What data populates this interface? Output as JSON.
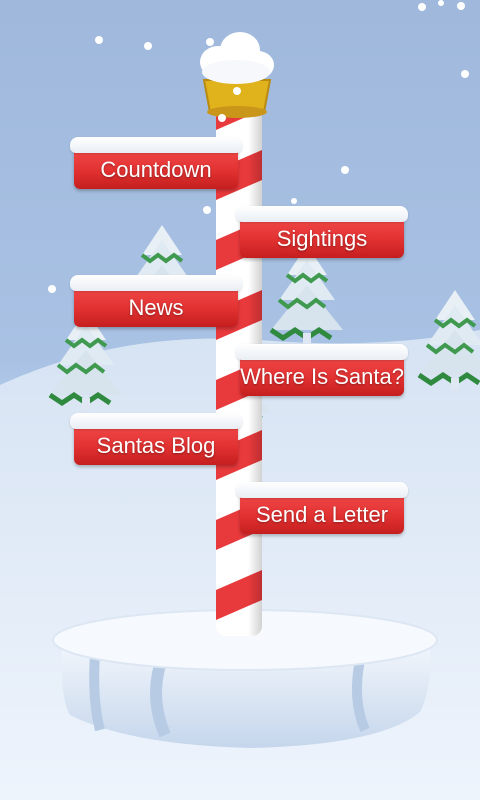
{
  "menu": {
    "countdown": "Countdown",
    "sightings": "Sightings",
    "news": "News",
    "where_is_santa": "Where Is Santa?",
    "santas_blog": "Santas Blog",
    "send_a_letter": "Send a Letter"
  },
  "colors": {
    "sign_red": "#e33232",
    "pole_red": "#e8393c",
    "sky": "#9fb8dc",
    "snow": "#ffffff",
    "cap_gold": "#e0b21c"
  },
  "icons": [
    "snowflake-icon",
    "pine-tree-icon",
    "north-pole-cap-icon"
  ]
}
